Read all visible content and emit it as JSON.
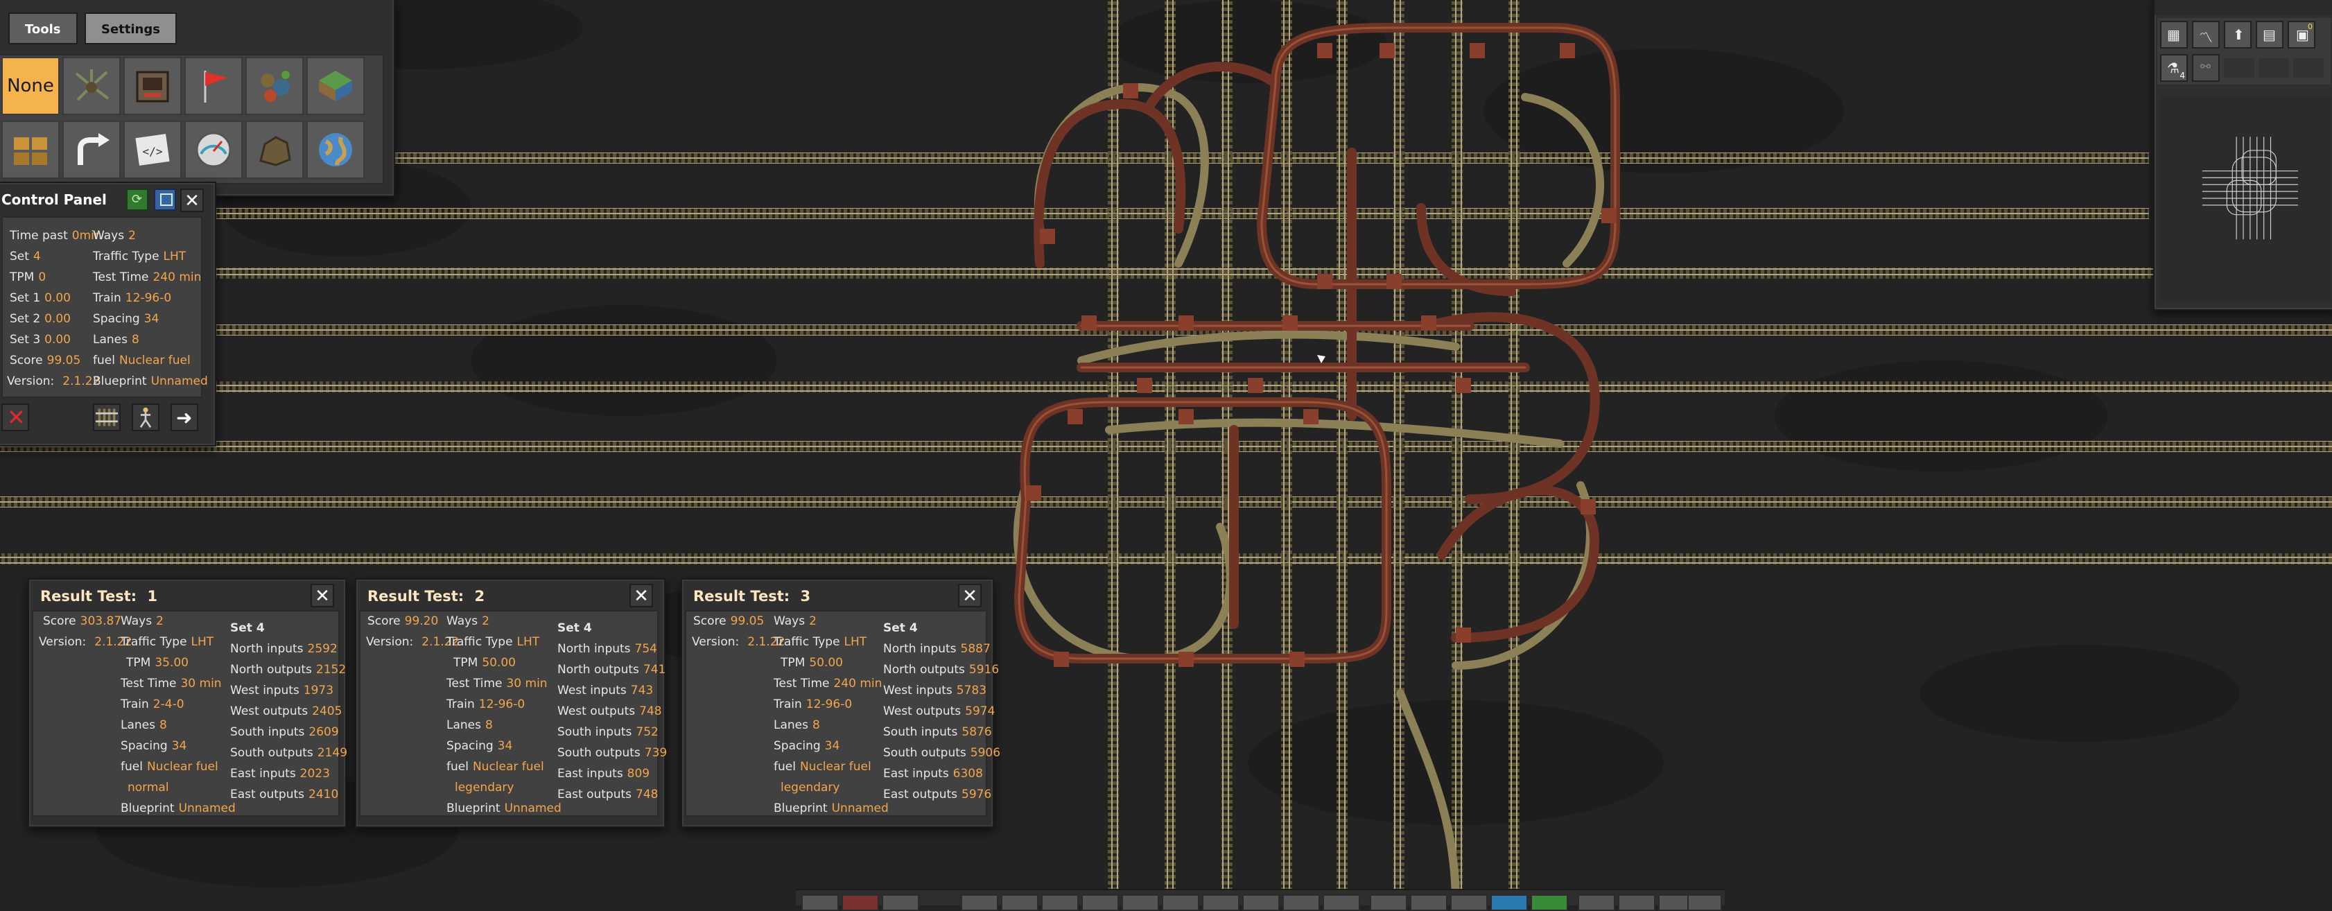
{
  "toolbar": {
    "tabs": [
      {
        "label": "Tools",
        "active": true
      },
      {
        "label": "Settings",
        "active": false
      }
    ],
    "none_label": "None",
    "tools": [
      {
        "icon": "tree-icon"
      },
      {
        "icon": "machine-icon"
      },
      {
        "icon": "flag-icon"
      },
      {
        "icon": "biters-icon"
      },
      {
        "icon": "terrain-icon"
      },
      {
        "icon": "chest-icon"
      },
      {
        "icon": "arrow-turn-icon"
      },
      {
        "icon": "code-icon"
      },
      {
        "icon": "speedometer-icon"
      },
      {
        "icon": "rock-icon"
      },
      {
        "icon": "globe-icon"
      }
    ]
  },
  "control_panel": {
    "title": "Control Panel",
    "left": [
      {
        "label": "Time past",
        "value": "0min"
      },
      {
        "label": "Set",
        "value": "4"
      },
      {
        "label": "TPM",
        "value": "0"
      },
      {
        "label": "Set 1",
        "value": "0.00"
      },
      {
        "label": "Set 2",
        "value": "0.00"
      },
      {
        "label": "Set 3",
        "value": "0.00"
      },
      {
        "label": "Score",
        "value": "99.05"
      },
      {
        "label": "Version:",
        "value": "2.1.22"
      }
    ],
    "right": [
      {
        "label": "Ways",
        "value": "2"
      },
      {
        "label": "Traffic Type",
        "value": "LHT"
      },
      {
        "label": "Test Time",
        "value": "240 min"
      },
      {
        "label": "Train",
        "value": "12-96-0"
      },
      {
        "label": "Spacing",
        "value": "34"
      },
      {
        "label": "Lanes",
        "value": "8"
      },
      {
        "label": "fuel",
        "value": "Nuclear fuel"
      },
      {
        "label": "Blueprint",
        "value": "Unnamed"
      }
    ]
  },
  "results": [
    {
      "title": "Result Test:",
      "number": "1",
      "score": {
        "label": "Score",
        "value": "303.87"
      },
      "version": {
        "label": "Version:",
        "value": "2.1.22"
      },
      "mid": [
        {
          "label": "Ways",
          "value": "2"
        },
        {
          "label": "Traffic Type",
          "value": "LHT"
        },
        {
          "label": "TPM",
          "value": "35.00"
        },
        {
          "label": "Test Time",
          "value": "30 min"
        },
        {
          "label": "Train",
          "value": "2-4-0"
        },
        {
          "label": "Lanes",
          "value": "8"
        },
        {
          "label": "Spacing",
          "value": "34"
        },
        {
          "label": "fuel",
          "value": "Nuclear fuel"
        },
        {
          "label": "",
          "value": "normal"
        },
        {
          "label": "Blueprint",
          "value": "Unnamed"
        }
      ],
      "set_label": "Set 4",
      "io": [
        {
          "label": "North inputs",
          "value": "2592"
        },
        {
          "label": "North outputs",
          "value": "2152"
        },
        {
          "label": "West inputs",
          "value": "1973"
        },
        {
          "label": "West outputs",
          "value": "2405"
        },
        {
          "label": "South inputs",
          "value": "2609"
        },
        {
          "label": "South outputs",
          "value": "2149"
        },
        {
          "label": "East inputs",
          "value": "2023"
        },
        {
          "label": "East outputs",
          "value": "2410"
        }
      ]
    },
    {
      "title": "Result Test:",
      "number": "2",
      "score": {
        "label": "Score",
        "value": "99.20"
      },
      "version": {
        "label": "Version:",
        "value": "2.1.22"
      },
      "mid": [
        {
          "label": "Ways",
          "value": "2"
        },
        {
          "label": "Traffic Type",
          "value": "LHT"
        },
        {
          "label": "TPM",
          "value": "50.00"
        },
        {
          "label": "Test Time",
          "value": "30 min"
        },
        {
          "label": "Train",
          "value": "12-96-0"
        },
        {
          "label": "Lanes",
          "value": "8"
        },
        {
          "label": "Spacing",
          "value": "34"
        },
        {
          "label": "fuel",
          "value": "Nuclear fuel"
        },
        {
          "label": "",
          "value": "legendary"
        },
        {
          "label": "Blueprint",
          "value": "Unnamed"
        }
      ],
      "set_label": "Set 4",
      "io": [
        {
          "label": "North inputs",
          "value": "754"
        },
        {
          "label": "North outputs",
          "value": "741"
        },
        {
          "label": "West inputs",
          "value": "743"
        },
        {
          "label": "West outputs",
          "value": "748"
        },
        {
          "label": "South inputs",
          "value": "752"
        },
        {
          "label": "South outputs",
          "value": "739"
        },
        {
          "label": "East inputs",
          "value": "809"
        },
        {
          "label": "East outputs",
          "value": "748"
        }
      ]
    },
    {
      "title": "Result Test:",
      "number": "3",
      "score": {
        "label": "Score",
        "value": "99.05"
      },
      "version": {
        "label": "Version:",
        "value": "2.1.22"
      },
      "mid": [
        {
          "label": "Ways",
          "value": "2"
        },
        {
          "label": "Traffic Type",
          "value": "LHT"
        },
        {
          "label": "TPM",
          "value": "50.00"
        },
        {
          "label": "Test Time",
          "value": "240 min"
        },
        {
          "label": "Train",
          "value": "12-96-0"
        },
        {
          "label": "Lanes",
          "value": "8"
        },
        {
          "label": "Spacing",
          "value": "34"
        },
        {
          "label": "fuel",
          "value": "Nuclear fuel"
        },
        {
          "label": "",
          "value": "legendary"
        },
        {
          "label": "Blueprint",
          "value": "Unnamed"
        }
      ],
      "set_label": "Set 4",
      "io": [
        {
          "label": "North inputs",
          "value": "5887"
        },
        {
          "label": "North outputs",
          "value": "5916"
        },
        {
          "label": "West inputs",
          "value": "5783"
        },
        {
          "label": "West outputs",
          "value": "5974"
        },
        {
          "label": "South inputs",
          "value": "5876"
        },
        {
          "label": "South outputs",
          "value": "5906"
        },
        {
          "label": "East inputs",
          "value": "6308"
        },
        {
          "label": "East outputs",
          "value": "5976"
        }
      ]
    }
  ],
  "minimap": {
    "toolbar_icons": [
      "map-grid-icon",
      "chart-icon",
      "rocket-icon",
      "book-icon",
      "train-icon",
      "research-icon",
      "graph-icon"
    ],
    "badge": "4",
    "train_badge": "0"
  },
  "colors": {
    "accent": "#f4a54a",
    "rail": "#8c8057",
    "elevated_rail": "#7a3a2a",
    "background": "#232323"
  }
}
